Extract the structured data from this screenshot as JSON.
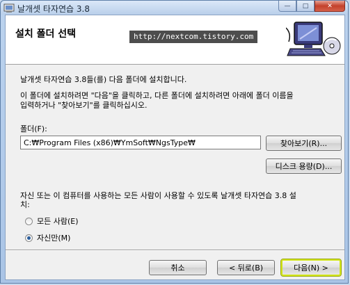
{
  "window": {
    "title": "날개셋 타자연습 3.8"
  },
  "titlebar_buttons": {
    "minimize": "—",
    "maximize": "□",
    "close": "✕"
  },
  "header": {
    "title": "설치 폴더 선택",
    "url_badge": "http://nextcom.tistory.com"
  },
  "body": {
    "line1": "날개셋 타자연습 3.8들(를) 다음 폴더에 설치합니다.",
    "line2": "이 폴더에 설치하려면 \"다음\"을 클릭하고, 다른 폴더에 설치하려면 아래에 폴더 이름을",
    "line3": "입력하거나 \"찾아보기\"를 클릭하십시오.",
    "folder_label": "폴더(F):",
    "folder_value": "C:₩Program Files (x86)₩YmSoft₩NgsType₩",
    "browse_label": "찾아보기(R)...",
    "disk_cost_label": "디스크 용량(D)...",
    "users_question_line1": "자신 또는 이 컴퓨터를 사용하는 모든 사람이 사용할 수 있도록 날개셋 타자연습 3.8 설",
    "users_question_line2": "치:",
    "radio_everyone": "모든 사람(E)",
    "radio_just_me": "자신만(M)",
    "selected_option": "just_me"
  },
  "footer": {
    "cancel_label": "취소",
    "back_label": "< 뒤로(B)",
    "next_label": "다음(N) >"
  }
}
